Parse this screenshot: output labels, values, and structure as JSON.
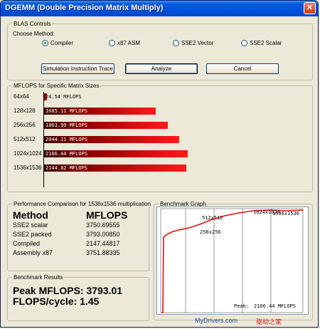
{
  "window": {
    "title": "DGEMM (Double Precision Matrix Multiply)",
    "close_glyph": "✕"
  },
  "blas": {
    "title": "BLAS Controls",
    "choose_label": "Choose Method:",
    "methods": [
      {
        "label": "Compiler",
        "checked": true
      },
      {
        "label": "x87 ASM",
        "checked": false
      },
      {
        "label": "SSE2 Vector",
        "checked": false
      },
      {
        "label": "SSE2 Scalar",
        "checked": false
      }
    ],
    "buttons": {
      "trace": "Simulation Instruction Trace",
      "analyze": "Analyze",
      "cancel": "Cancel"
    }
  },
  "mflops": {
    "title": "MFLOPS for Specific Matrix Sizes",
    "max_value": 2200,
    "rows": [
      {
        "size": "64x64",
        "label": "24.54 MFLOPS",
        "value": 24.54
      },
      {
        "size": "128x128",
        "label": "1685.11 MFLOPS",
        "value": 1685.11
      },
      {
        "size": "256x256",
        "label": "1863.99 MFLOPS",
        "value": 1863.99
      },
      {
        "size": "512x512",
        "label": "2044.11 MFLOPS",
        "value": 2044.11
      },
      {
        "size": "1024x1024",
        "label": "2166.44 MFLOPS",
        "value": 2166.44
      },
      {
        "size": "1536x1536",
        "label": "2144.82 MFLOPS",
        "value": 2144.82
      }
    ]
  },
  "perf": {
    "title": "Performance Comparison for 1536x1536 multiplication",
    "headers": {
      "method": "Method",
      "mflops": "MFLOPS"
    },
    "rows": [
      {
        "method": "SSE2 scalar",
        "value": "3750.69555"
      },
      {
        "method": "SSE2 packed",
        "value": "3793.00850"
      },
      {
        "method": "Compiled",
        "value": "2147.44817"
      },
      {
        "method": "Assembly x87",
        "value": "3751.88335"
      }
    ]
  },
  "results": {
    "title": "Benchmark Results",
    "peak": "Peak MFLOPS: 3793.01",
    "flops_cycle": "FLOPS/cycle: 1.45"
  },
  "graph": {
    "title": "Benchmark Graph",
    "labels": [
      "256x256",
      "512x512",
      "1024x1024",
      "1536x1536"
    ],
    "peak_label": "Peak:",
    "peak_value": "2166.44 MFLOPS",
    "line_color": "#e01010",
    "grid_color": "#000000"
  },
  "watermark": {
    "site": "MyDrivers.com",
    "cn": "驱动之家"
  }
}
